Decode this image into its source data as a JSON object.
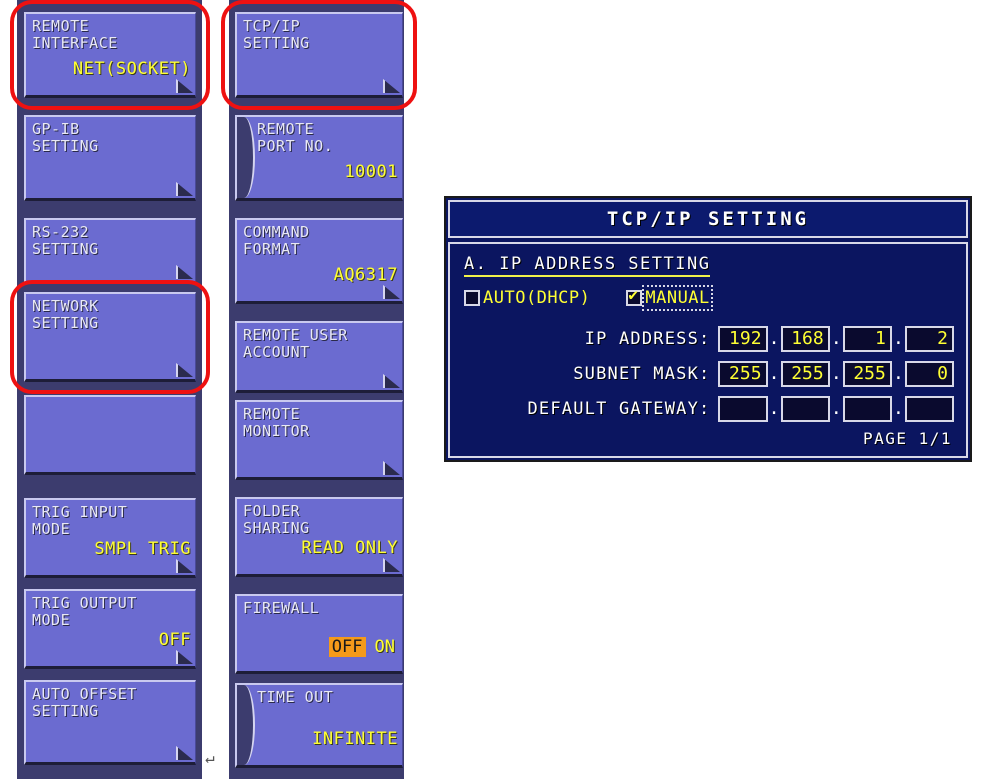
{
  "left_column": {
    "buttons": [
      {
        "label": "REMOTE\nINTERFACE",
        "value": "NET(SOCKET)",
        "highlighted": true,
        "corner": true,
        "notch": false
      },
      {
        "label": "GP-IB\nSETTING",
        "value": "",
        "highlighted": false,
        "corner": true,
        "notch": false
      },
      {
        "label": "RS-232\nSETTING",
        "value": "",
        "highlighted": false,
        "corner": true,
        "notch": false
      },
      {
        "label": "NETWORK\nSETTING",
        "value": "",
        "highlighted": true,
        "corner": true,
        "notch": false
      },
      {
        "label": "",
        "value": "",
        "highlighted": false,
        "corner": false,
        "notch": false
      },
      {
        "label": "TRIG INPUT\nMODE",
        "value": "SMPL TRIG",
        "highlighted": false,
        "corner": true,
        "notch": false
      },
      {
        "label": "TRIG OUTPUT\nMODE",
        "value": "OFF",
        "highlighted": false,
        "corner": true,
        "notch": false
      },
      {
        "label": "AUTO OFFSET\nSETTING",
        "value": "",
        "highlighted": false,
        "corner": true,
        "notch": false
      }
    ]
  },
  "middle_column": {
    "buttons": [
      {
        "label": "TCP/IP\nSETTING",
        "value": "",
        "highlighted": true,
        "corner": true,
        "notch": false
      },
      {
        "label": "REMOTE\nPORT NO.",
        "value": "10001",
        "highlighted": false,
        "corner": false,
        "notch": true
      },
      {
        "label": "COMMAND\nFORMAT",
        "value": "AQ6317",
        "highlighted": false,
        "corner": true,
        "notch": false
      },
      {
        "label": "REMOTE USER\nACCOUNT",
        "value": "",
        "highlighted": false,
        "corner": true,
        "notch": false
      },
      {
        "label": "REMOTE\nMONITOR",
        "value": "",
        "highlighted": false,
        "corner": true,
        "notch": false
      },
      {
        "label": "FOLDER\nSHARING",
        "value": "READ ONLY",
        "highlighted": false,
        "corner": true,
        "notch": false
      },
      {
        "label": "FIREWALL",
        "value": "",
        "highlighted": false,
        "corner": false,
        "notch": false,
        "toggle": {
          "options": [
            "OFF",
            "ON"
          ],
          "selected": "OFF"
        }
      },
      {
        "label": "TIME OUT",
        "value": "INFINITE",
        "highlighted": false,
        "corner": false,
        "notch": true
      }
    ]
  },
  "dialog": {
    "title": "TCP/IP SETTING",
    "section_title": "A. IP ADDRESS SETTING",
    "mode_options": [
      {
        "label": "AUTO(DHCP)",
        "checked": false,
        "selected": false
      },
      {
        "label": "MANUAL",
        "checked": true,
        "selected": true
      }
    ],
    "fields": [
      {
        "label": "IP ADDRESS:",
        "octets": [
          "192",
          "168",
          "1",
          "2"
        ]
      },
      {
        "label": "SUBNET MASK:",
        "octets": [
          "255",
          "255",
          "255",
          "0"
        ]
      },
      {
        "label": "DEFAULT GATEWAY:",
        "octets": [
          "",
          "",
          "",
          ""
        ]
      }
    ],
    "separator": ".",
    "page_indicator": "PAGE 1/1"
  },
  "colors": {
    "panel_background": "#3c3c6e",
    "button_face": "#6b6bd0",
    "button_value_text": "#ffff33",
    "button_label_text": "#e8e8f5",
    "dialog_background": "#0b1560",
    "dialog_border": "#d8d8e8",
    "annotation_red": "#ee1111",
    "toggle_active": "#f59a1a"
  },
  "annotations": {
    "cursor_glyph": "↵"
  }
}
